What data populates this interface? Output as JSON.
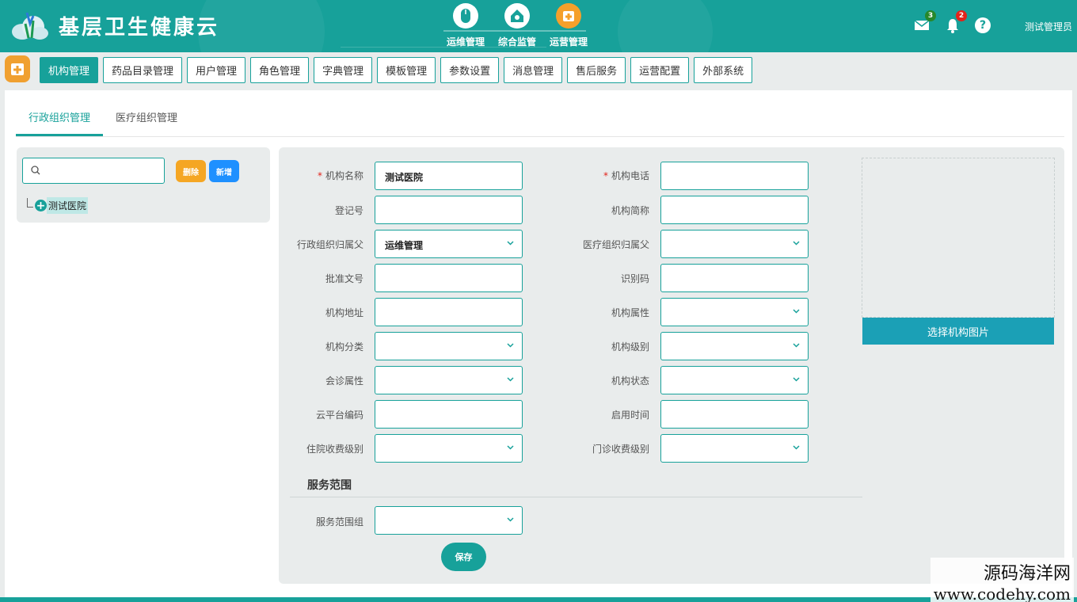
{
  "header": {
    "app_title": "基层卫生健康云",
    "modules": [
      {
        "label": "运维管理",
        "icon": "mouse-icon",
        "active": false
      },
      {
        "label": "综合监管",
        "icon": "house-monitor-icon",
        "active": false
      },
      {
        "label": "运营管理",
        "icon": "hospital-calendar-icon",
        "active": true
      }
    ],
    "mail_count": "3",
    "notification_count": "2",
    "help_label": "?",
    "user_name": "测试管理员"
  },
  "subnav": {
    "items": [
      "机构管理",
      "药品目录管理",
      "用户管理",
      "角色管理",
      "字典管理",
      "模板管理",
      "参数设置",
      "消息管理",
      "售后服务",
      "运营配置",
      "外部系统"
    ],
    "active_index": 0
  },
  "tabs": [
    "行政组织管理",
    "医疗组织管理"
  ],
  "tree": {
    "search_placeholder": "",
    "delete_label": "删除",
    "add_label": "新增",
    "node_label": "测试医院"
  },
  "form": {
    "left_fields": [
      {
        "label": "机构名称",
        "required": true,
        "value": "测试医院",
        "type": "input"
      },
      {
        "label": "登记号",
        "required": false,
        "value": "",
        "type": "input"
      },
      {
        "label": "行政组织归属父",
        "required": false,
        "value": "运维管理",
        "type": "select"
      },
      {
        "label": "批准文号",
        "required": false,
        "value": "",
        "type": "input"
      },
      {
        "label": "机构地址",
        "required": false,
        "value": "",
        "type": "input"
      },
      {
        "label": "机构分类",
        "required": false,
        "value": "",
        "type": "select"
      },
      {
        "label": "会诊属性",
        "required": false,
        "value": "",
        "type": "select"
      },
      {
        "label": "云平台编码",
        "required": false,
        "value": "",
        "type": "input"
      },
      {
        "label": "住院收费级别",
        "required": false,
        "value": "",
        "type": "select"
      }
    ],
    "right_fields": [
      {
        "label": "机构电话",
        "required": true,
        "value": "",
        "type": "input"
      },
      {
        "label": "机构简称",
        "required": false,
        "value": "",
        "type": "input"
      },
      {
        "label": "医疗组织归属父",
        "required": false,
        "value": "",
        "type": "select"
      },
      {
        "label": "识别码",
        "required": false,
        "value": "",
        "type": "input"
      },
      {
        "label": "机构属性",
        "required": false,
        "value": "",
        "type": "select"
      },
      {
        "label": "机构级别",
        "required": false,
        "value": "",
        "type": "select"
      },
      {
        "label": "机构状态",
        "required": false,
        "value": "",
        "type": "select"
      },
      {
        "label": "启用时间",
        "required": false,
        "value": "",
        "type": "input"
      },
      {
        "label": "门诊收费级别",
        "required": false,
        "value": "",
        "type": "select"
      }
    ],
    "section_title": "服务范围",
    "service_field": {
      "label": "服务范围组",
      "value": "",
      "type": "select"
    },
    "save_label": "保存",
    "pick_image_label": "选择机构图片"
  },
  "watermark": {
    "line1": "源码海洋网",
    "line2": "www.codehy.com"
  },
  "colors": {
    "primary": "#17a19a",
    "accent_orange": "#f5a623",
    "accent_blue": "#1e90ff",
    "pick_button": "#1ba0b6",
    "badge_green": "#27882b",
    "badge_red": "#e2231a"
  }
}
